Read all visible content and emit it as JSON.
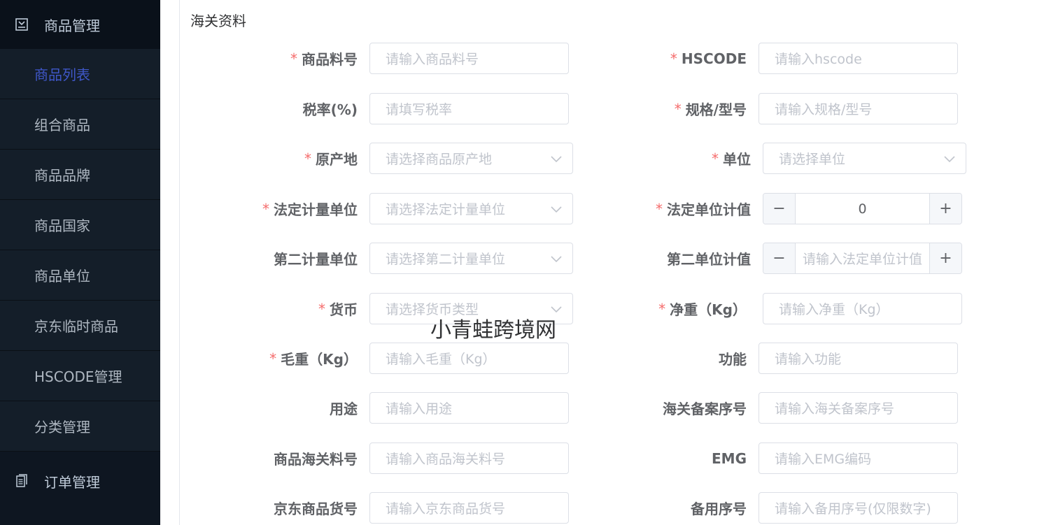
{
  "sidebar": {
    "group1": {
      "label": "商品管理",
      "icon": "box-icon"
    },
    "items": [
      {
        "label": "商品列表",
        "active": true
      },
      {
        "label": "组合商品"
      },
      {
        "label": "商品品牌"
      },
      {
        "label": "商品国家"
      },
      {
        "label": "商品单位"
      },
      {
        "label": "京东临时商品"
      },
      {
        "label": "HSCODE管理"
      },
      {
        "label": "分类管理"
      }
    ],
    "group2": {
      "label": "订单管理",
      "icon": "document-icon"
    }
  },
  "section": {
    "title": "海关资料"
  },
  "form": {
    "item_no": {
      "label": "商品料号",
      "placeholder": "请输入商品料号",
      "required": true
    },
    "hscode": {
      "label": "HSCODE",
      "placeholder": "请输入hscode",
      "required": true
    },
    "tax_rate": {
      "label": "税率(%)",
      "placeholder": "请填写税率",
      "required": false
    },
    "spec_model": {
      "label": "规格/型号",
      "placeholder": "请输入规格/型号",
      "required": true
    },
    "origin": {
      "label": "原产地",
      "placeholder": "请选择商品原产地",
      "required": true
    },
    "unit": {
      "label": "单位",
      "placeholder": "请选择单位",
      "required": true
    },
    "legal_unit": {
      "label": "法定计量单位",
      "placeholder": "请选择法定计量单位",
      "required": true
    },
    "legal_unit_value": {
      "label": "法定单位计值",
      "value": "0",
      "required": true,
      "minus": "−",
      "plus": "+"
    },
    "second_unit": {
      "label": "第二计量单位",
      "placeholder": "请选择第二计量单位",
      "required": false
    },
    "second_unit_value": {
      "label": "第二单位计值",
      "placeholder": "请输入法定单位计值",
      "required": false,
      "minus": "−",
      "plus": "+"
    },
    "currency": {
      "label": "货币",
      "placeholder": "请选择货币类型",
      "required": true
    },
    "net_weight": {
      "label": "净重（Kg）",
      "placeholder": "请输入净重（Kg）",
      "required": true
    },
    "gross_weight": {
      "label": "毛重（Kg）",
      "placeholder": "请输入毛重（Kg）",
      "required": true
    },
    "function": {
      "label": "功能",
      "placeholder": "请输入功能",
      "required": false
    },
    "usage": {
      "label": "用途",
      "placeholder": "请输入用途",
      "required": false
    },
    "customs_record_no": {
      "label": "海关备案序号",
      "placeholder": "请输入海关备案序号",
      "required": false
    },
    "customs_item_no": {
      "label": "商品海关料号",
      "placeholder": "请输入商品海关料号",
      "required": false
    },
    "emg": {
      "label": "EMG",
      "placeholder": "请输入EMG编码",
      "required": false
    },
    "jd_goods_no": {
      "label": "京东商品货号",
      "placeholder": "请输入京东商品货号",
      "required": false
    },
    "spare_no": {
      "label": "备用序号",
      "placeholder": "请输入备用序号(仅限数字)",
      "required": false
    }
  },
  "watermark": "小青蛙跨境网",
  "required_mark": "*",
  "colors": {
    "sidebar_bg": "#0e1621",
    "active_item": "#3f57c8",
    "required": "#f56c6c"
  }
}
